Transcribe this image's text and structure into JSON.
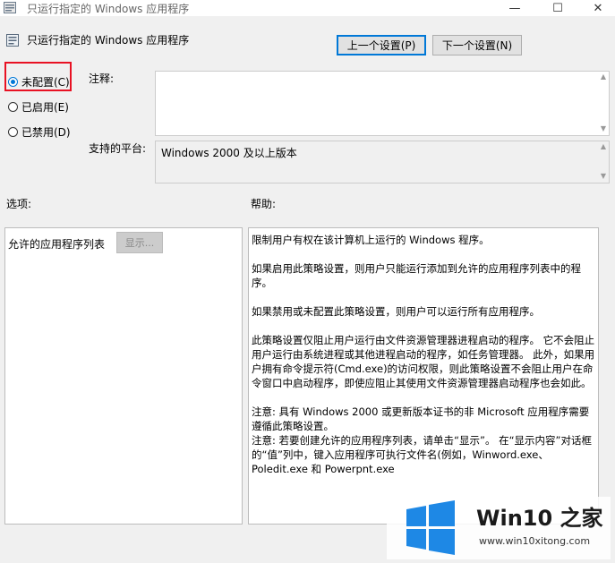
{
  "window": {
    "title": "只运行指定的 Windows 应用程序",
    "min_glyph": "—",
    "max_glyph": "☐",
    "close_glyph": "✕"
  },
  "header": {
    "policy_title": "只运行指定的 Windows 应用程序",
    "prev_label": "上一个设置(P)",
    "next_label": "下一个设置(N)"
  },
  "state": {
    "options": [
      {
        "label": "未配置(C)",
        "checked": true
      },
      {
        "label": "已启用(E)",
        "checked": false
      },
      {
        "label": "已禁用(D)",
        "checked": false
      }
    ]
  },
  "comment": {
    "label": "注释:",
    "value": ""
  },
  "platform": {
    "label": "支持的平台:",
    "value": "Windows 2000 及以上版本"
  },
  "options_section": {
    "label": "选项:",
    "allowed_apps_label": "允许的应用程序列表",
    "show_button": "显示..."
  },
  "help": {
    "label": "帮助:",
    "paragraphs": [
      "限制用户有权在该计算机上运行的 Windows 程序。",
      "如果启用此策略设置，则用户只能运行添加到允许的应用程序列表中的程序。",
      "如果禁用或未配置此策略设置，则用户可以运行所有应用程序。",
      "此策略设置仅阻止用户运行由文件资源管理器进程启动的程序。 它不会阻止用户运行由系统进程或其他进程启动的程序，如任务管理器。 此外，如果用户拥有命令提示符(Cmd.exe)的访问权限，则此策略设置不会阻止用户在命令窗口中启动程序，即使应阻止其使用文件资源管理器启动程序也会如此。",
      "注意: 具有 Windows 2000 或更新版本证书的非 Microsoft 应用程序需要遵循此策略设置。",
      "注意: 若要创建允许的应用程序列表，请单击“显示”。 在“显示内容”对话框的“值”列中，键入应用程序可执行文件名(例如，Winword.exe、Poledit.exe 和 Powerpnt.exe"
    ]
  },
  "watermark": {
    "brand": "Win10 之家",
    "url": "www.win10xitong.com"
  },
  "colors": {
    "accent": "#0078d7",
    "highlight": "#e81123",
    "watermark_blue": "#1e88e5"
  }
}
